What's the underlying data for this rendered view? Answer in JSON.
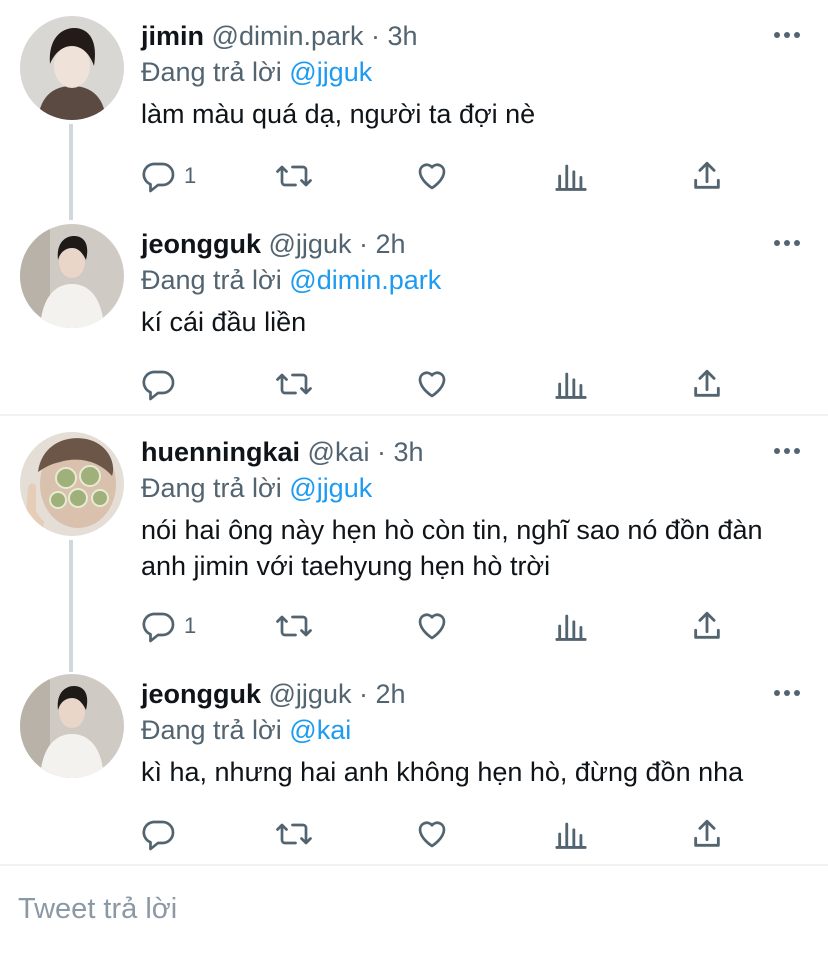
{
  "tweets": [
    {
      "name": "jimin",
      "handle": "@dimin.park",
      "separator": "·",
      "time": "3h",
      "replying_prefix": "Đang trả lời",
      "replying_to": "@jjguk",
      "text": "làm màu quá dạ, người ta đợi nè",
      "reply_count": "1"
    },
    {
      "name": "jeongguk",
      "handle": "@jjguk",
      "separator": "·",
      "time": "2h",
      "replying_prefix": "Đang trả lời",
      "replying_to": "@dimin.park",
      "text": "kí cái đầu liền",
      "reply_count": ""
    },
    {
      "name": "huenningkai",
      "handle": "@kai",
      "separator": "·",
      "time": "3h",
      "replying_prefix": "Đang trả lời",
      "replying_to": "@jjguk",
      "text": "nói hai ông này hẹn hò còn tin, nghĩ sao nó đồn đàn anh jimin với taehyung hẹn hò trời",
      "reply_count": "1"
    },
    {
      "name": "jeongguk",
      "handle": "@jjguk",
      "separator": "·",
      "time": "2h",
      "replying_prefix": "Đang trả lời",
      "replying_to": "@kai",
      "text": "kì ha, nhưng hai anh không hẹn hò, đừng đồn nha",
      "reply_count": ""
    }
  ],
  "reply_box": {
    "placeholder": "Tweet trả lời"
  },
  "colors": {
    "text": "#0f1419",
    "secondary": "#536471",
    "link": "#1d9bf0",
    "divider": "#eff3f4",
    "thread_line": "#cfd9de"
  },
  "icons": {
    "reply": "reply-icon",
    "retweet": "retweet-icon",
    "like": "heart-icon",
    "views": "views-icon",
    "share": "share-icon",
    "more": "more-icon"
  }
}
